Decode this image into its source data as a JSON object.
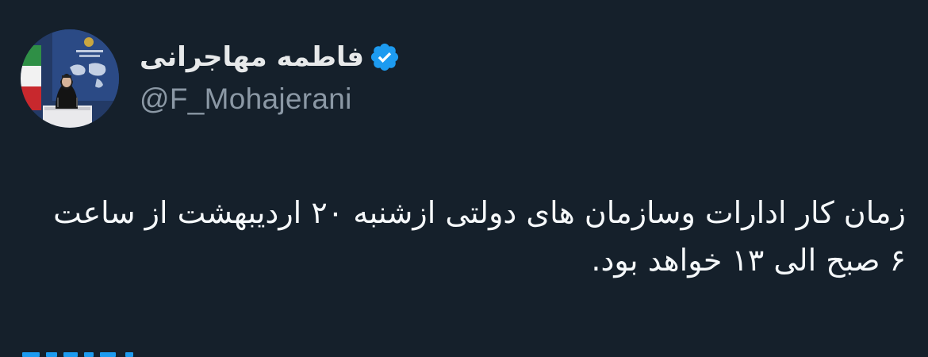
{
  "author": {
    "display_name": "فاطمه مهاجرانی",
    "handle": "@F_Mohajerani",
    "verified": true,
    "avatar_icon": "profile-photo",
    "verified_icon": "verified-badge-icon"
  },
  "tweet": {
    "text": "زمان کار ادارات وسازمان های دولتی ازشنبه ۲۰ اردیبهشت از ساعت ۶ صبح الی ۱۳ خواهد بود."
  },
  "colors": {
    "background": "#15202b",
    "name": "#e7e9ea",
    "handle": "#8b98a5",
    "verified": "#1d9bf0",
    "text": "#f5f8fa"
  }
}
